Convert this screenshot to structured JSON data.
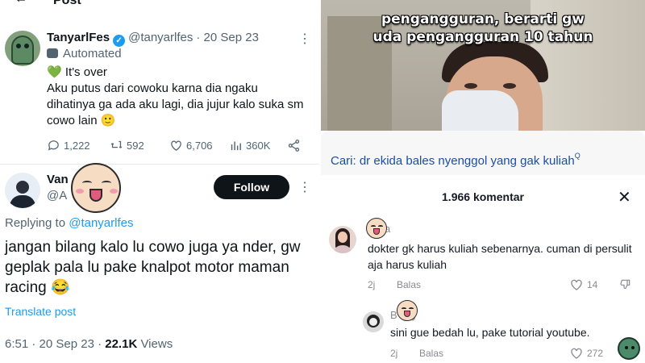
{
  "left": {
    "topbar": {
      "title": "Post"
    },
    "tweet1": {
      "name": "TanyarlFes",
      "handle": "@tanyarlfes",
      "date": "· 20 Sep 23",
      "label": "Automated",
      "text_line1": "It's over",
      "text_body": "Aku putus dari cowoku karna dia ngaku dihatinya ga ada aku lagi, dia jujur kalo suka sm cowo lain 🙂",
      "replies": "1,222",
      "reposts": "592",
      "likes": "6,706",
      "views": "360K"
    },
    "tweet2": {
      "name": "Van",
      "handle": "@A",
      "follow_label": "Follow",
      "replying_prefix": "Replying to ",
      "replying_to": "@tanyarlfes",
      "text": "jangan bilang kalo lu cowo juga ya nder, gw geplak pala lu pake knalpot motor maman racing 😂",
      "translate_label": "Translate post",
      "time": "6:51 · 20 Sep 23 · ",
      "views_count": "22.1K",
      "views_label": " Views"
    },
    "colors": {
      "link": "#1d9bf0",
      "follow_bg": "#0f1419",
      "muted": "#536471"
    }
  },
  "right": {
    "video": {
      "caption_line1": "pengangguran, berarti gw",
      "caption_line2": "uda pengangguran 10 tahun"
    },
    "search": {
      "label": "Cari:",
      "query": "dr ekida bales nyenggol yang gak kuliah",
      "sup": "Q"
    },
    "comments_header": {
      "count_label": "1.966 komentar",
      "close": "✕"
    },
    "comments": [
      {
        "name": "j",
        "name_suffix": "a",
        "text": "dokter gk harus kuliah sebenarnya. cuman di persulit aja harus kuliah",
        "time": "2j",
        "reply": "Balas",
        "likes": "14"
      },
      {
        "name": "B",
        "name_suffix": "y",
        "text": "sini gue bedah lu, pake tutorial youtube.",
        "time": "2j",
        "reply": "Balas",
        "likes": "272"
      }
    ],
    "colors": {
      "search_text": "#1a4fa3",
      "muted": "#8a8b91"
    }
  }
}
